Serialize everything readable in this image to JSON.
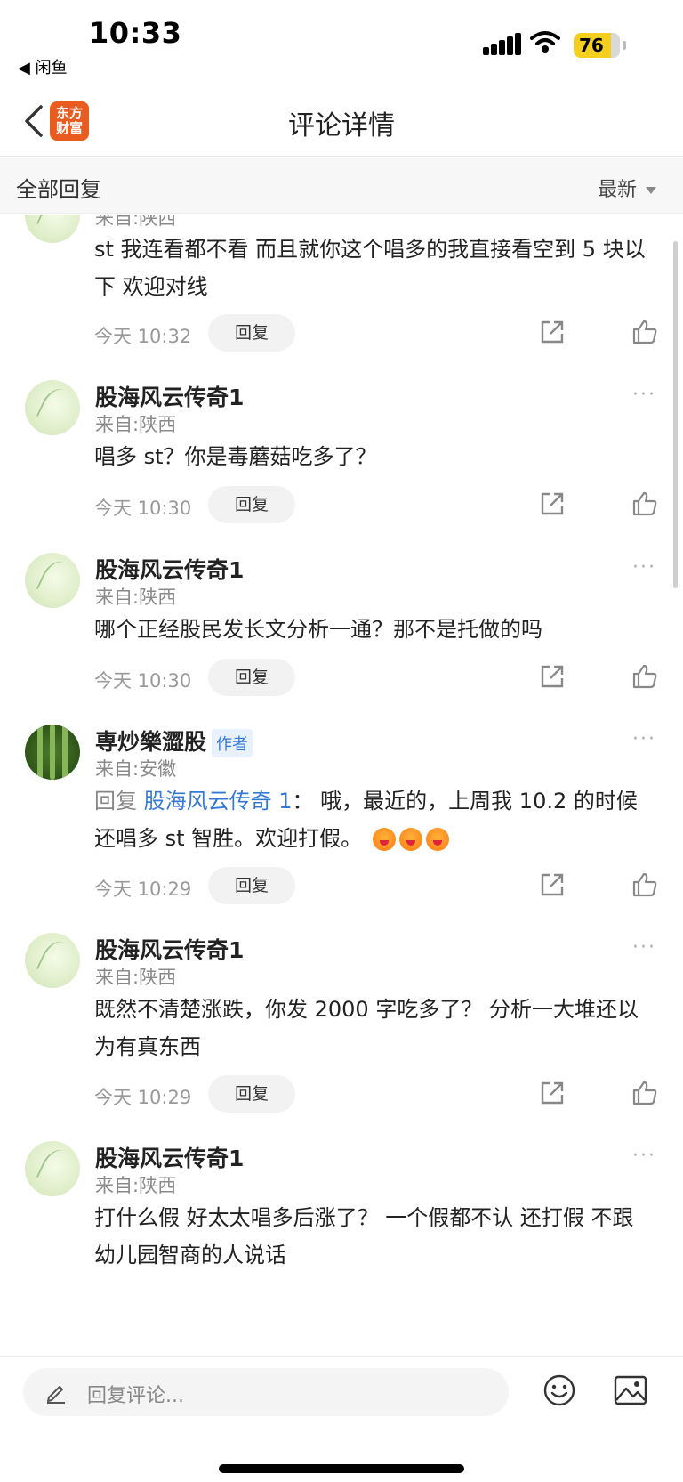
{
  "status_bar": {
    "time": "10:33",
    "back_app": "◀ 闲鱼",
    "battery": "76"
  },
  "header": {
    "logo_line1": "东方",
    "logo_line2": "财富",
    "title": "评论详情"
  },
  "subheader": {
    "left": "全部回复",
    "sort": "最新"
  },
  "reply_button_label": "回复",
  "more_glyph": "···",
  "comments": [
    {
      "user": "",
      "location": "来自:陕西",
      "text": "st 我连看都不看 而且就你这个唱多的我直接看空到 5 块以下 欢迎对线",
      "time": "今天 10:32"
    },
    {
      "user": "股海风云传奇1",
      "location": "来自:陕西",
      "text": "唱多 st？你是毒蘑菇吃多了？",
      "time": "今天 10:30"
    },
    {
      "user": "股海风云传奇1",
      "location": "来自:陕西",
      "text": "哪个正经股民发长文分析一通？那不是托做的吗",
      "time": "今天 10:30"
    },
    {
      "user": "専炒樂澀股",
      "badge": "作者",
      "location": "来自:安徽",
      "reply_prefix": "回复",
      "reply_target": "股海风云传奇 1",
      "text": "：  哦，最近的，上周我 10.2 的时候还唱多 st 智胜。欢迎打假。",
      "time": "今天 10:29"
    },
    {
      "user": "股海风云传奇1",
      "location": "来自:陕西",
      "text": "既然不清楚涨跌，你发 2000 字吃多了？ 分析一大堆还以为有真东西",
      "time": "今天 10:29"
    },
    {
      "user": "股海风云传奇1",
      "location": "来自:陕西",
      "text": "打什么假 好太太唱多后涨了？ 一个假都不认 还打假 不跟幼儿园智商的人说话",
      "time": ""
    }
  ],
  "bottom_bar": {
    "placeholder": "回复评论..."
  }
}
